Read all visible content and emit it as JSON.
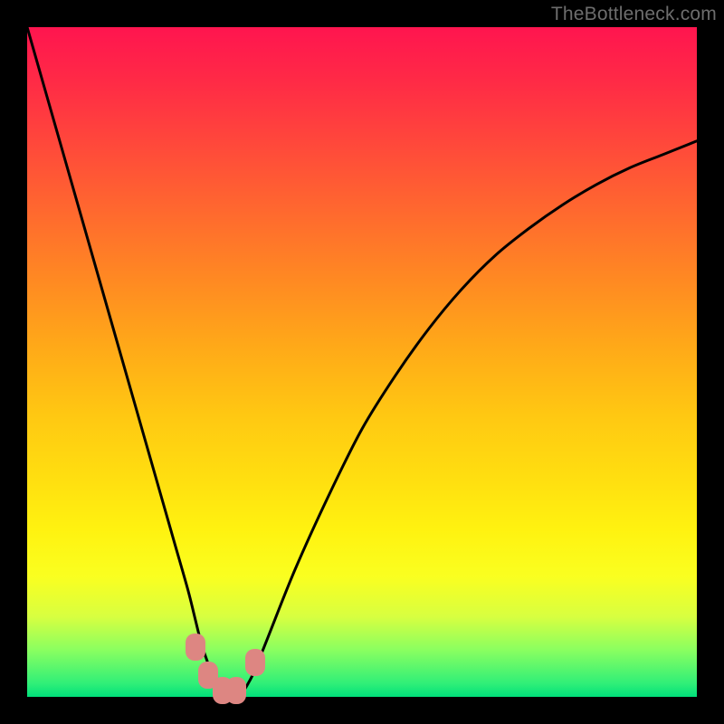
{
  "watermark": "TheBottleneck.com",
  "chart_data": {
    "type": "line",
    "title": "",
    "xlabel": "",
    "ylabel": "",
    "xlim": [
      0,
      100
    ],
    "ylim": [
      0,
      100
    ],
    "grid": false,
    "legend": false,
    "background_gradient": {
      "top_color": "#ff154f",
      "bottom_color": "#00e07a",
      "description": "red-orange-yellow-green vertical gradient"
    },
    "series": [
      {
        "name": "bottleneck-curve",
        "color": "#000000",
        "x": [
          0,
          4,
          8,
          12,
          16,
          20,
          22,
          24,
          25,
          26,
          27,
          28,
          29,
          30,
          31,
          32,
          33,
          34,
          36,
          40,
          45,
          50,
          55,
          60,
          65,
          70,
          75,
          80,
          85,
          90,
          95,
          100
        ],
        "y": [
          100,
          86,
          72,
          58,
          44,
          30,
          23,
          16,
          12,
          8,
          5,
          2,
          0.5,
          0,
          0,
          0.5,
          2,
          4,
          9,
          19,
          30,
          40,
          48,
          55,
          61,
          66,
          70,
          73.5,
          76.5,
          79,
          81,
          83
        ]
      }
    ],
    "markers": [
      {
        "name": "marker-a",
        "x": 25.2,
        "y": 7.5,
        "color": "#dd8682"
      },
      {
        "name": "marker-b",
        "x": 27.0,
        "y": 3.2,
        "color": "#dd8682"
      },
      {
        "name": "marker-c",
        "x": 29.2,
        "y": 1.0,
        "color": "#dd8682"
      },
      {
        "name": "marker-d",
        "x": 31.2,
        "y": 1.0,
        "color": "#dd8682"
      },
      {
        "name": "marker-e",
        "x": 34.0,
        "y": 5.2,
        "color": "#dd8682"
      }
    ]
  }
}
